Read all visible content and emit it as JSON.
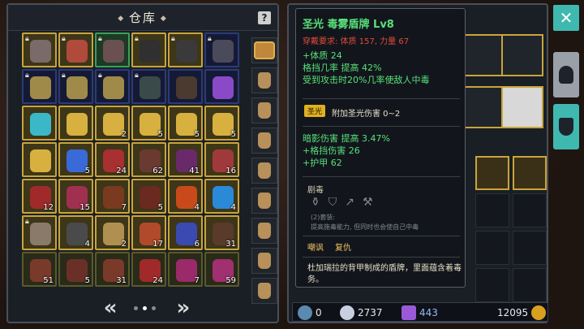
{
  "warehouse": {
    "title": "仓库",
    "help_label": "?",
    "pager": {
      "prev": "«",
      "next": "»",
      "pages": 3,
      "current": 2
    },
    "slots": [
      {
        "count": "",
        "color": "#7a6a6a",
        "rarity": "gold",
        "locked": true
      },
      {
        "count": "",
        "color": "#b04a3a",
        "rarity": "gold",
        "locked": true
      },
      {
        "count": "",
        "color": "#6a5050",
        "rarity": "green",
        "locked": true
      },
      {
        "count": "",
        "color": "#303030",
        "rarity": "gold",
        "locked": true
      },
      {
        "count": "",
        "color": "#3a3a3a",
        "rarity": "gold",
        "locked": true
      },
      {
        "count": "",
        "color": "#4a4a5a",
        "rarity": "blue",
        "locked": true
      },
      {
        "count": "",
        "color": "#a08a4a",
        "rarity": "blue",
        "locked": true
      },
      {
        "count": "",
        "color": "#a08a4a",
        "rarity": "blue",
        "locked": true
      },
      {
        "count": "",
        "color": "#a08a4a",
        "rarity": "blue",
        "locked": true
      },
      {
        "count": "",
        "color": "#3a4a4a",
        "rarity": "blue",
        "locked": true
      },
      {
        "count": "",
        "color": "#4a3a30",
        "rarity": "blue",
        "locked": false
      },
      {
        "count": "",
        "color": "#8a4ac8",
        "rarity": "blue",
        "locked": false
      },
      {
        "count": "",
        "color": "#3ab8c8",
        "rarity": "gold",
        "locked": false
      },
      {
        "count": "",
        "color": "#d8b040",
        "rarity": "gold",
        "locked": false
      },
      {
        "count": "2",
        "color": "#d8b040",
        "rarity": "gold",
        "locked": false
      },
      {
        "count": "5",
        "color": "#d8b040",
        "rarity": "gold",
        "locked": false
      },
      {
        "count": "5",
        "color": "#d8b040",
        "rarity": "gold",
        "locked": false
      },
      {
        "count": "5",
        "color": "#d8b040",
        "rarity": "gold",
        "locked": false
      },
      {
        "count": "",
        "color": "#d8b040",
        "rarity": "gold",
        "locked": false
      },
      {
        "count": "5",
        "color": "#3a6ad8",
        "rarity": "gold",
        "locked": false
      },
      {
        "count": "24",
        "color": "#a83030",
        "rarity": "gold",
        "locked": false
      },
      {
        "count": "62",
        "color": "#6a3a30",
        "rarity": "gold",
        "locked": false
      },
      {
        "count": "41",
        "color": "#6a2a6a",
        "rarity": "gold",
        "locked": false
      },
      {
        "count": "16",
        "color": "#a03a3a",
        "rarity": "gold",
        "locked": false
      },
      {
        "count": "12",
        "color": "#a02a2a",
        "rarity": "gold",
        "locked": false
      },
      {
        "count": "15",
        "color": "#a03050",
        "rarity": "gold",
        "locked": false
      },
      {
        "count": "7",
        "color": "#7a3a20",
        "rarity": "gold",
        "locked": false
      },
      {
        "count": "5",
        "color": "#6a2a20",
        "rarity": "gold",
        "locked": false
      },
      {
        "count": "4",
        "color": "#c84a1a",
        "rarity": "gold",
        "locked": false
      },
      {
        "count": "4",
        "color": "#2a8ad8",
        "rarity": "gold",
        "locked": false
      },
      {
        "count": "",
        "color": "#8a7a6a",
        "rarity": "gold",
        "locked": true
      },
      {
        "count": "4",
        "color": "#4a4a4a",
        "rarity": "gold",
        "locked": false
      },
      {
        "count": "2",
        "color": "#b09050",
        "rarity": "gold",
        "locked": false
      },
      {
        "count": "17",
        "color": "#b04a2a",
        "rarity": "gold",
        "locked": false
      },
      {
        "count": "6",
        "color": "#3a4ab0",
        "rarity": "gold",
        "locked": false
      },
      {
        "count": "31",
        "color": "#5a3a2a",
        "rarity": "gold",
        "locked": false
      },
      {
        "count": "51",
        "color": "#7a3a2a",
        "rarity": "dark",
        "locked": false
      },
      {
        "count": "5",
        "color": "#6a3028",
        "rarity": "dark",
        "locked": false
      },
      {
        "count": "31",
        "color": "#7a3a2a",
        "rarity": "dark",
        "locked": false
      },
      {
        "count": "24",
        "color": "#a02a2a",
        "rarity": "dark",
        "locked": false
      },
      {
        "count": "7",
        "color": "#9a2a6a",
        "rarity": "dark",
        "locked": false
      },
      {
        "count": "59",
        "color": "#a03070",
        "rarity": "dark",
        "locked": false
      }
    ],
    "side_bags": [
      "chest",
      "bag",
      "bag",
      "bag",
      "bag",
      "bag",
      "bag",
      "bag",
      "bag"
    ]
  },
  "tooltip": {
    "title": "圣光  毒雾盾牌  Lv8",
    "requirement": "穿戴要求:  体质 157, 力量 67",
    "stats_main": [
      "+体质 24",
      "格挡几率 提高 42%",
      "受到攻击时20%几率使敌人中毒"
    ],
    "badge": "圣光",
    "badge_text": "附加圣光伤害 0~2",
    "stats_secondary": [
      "暗影伤害 提高 3.47%",
      "+格挡伤害 26",
      "+护甲 62"
    ],
    "set_name": "剧毒",
    "set_icons": [
      "⚱",
      "⛉",
      "↗",
      "⚒"
    ],
    "set_bonus": "(2)套装:\n提高施毒能力, 但同时也会使自己中毒",
    "skills": [
      "嘲讽",
      "复仇"
    ],
    "description": "杜加瑞拉的背甲制成的盾牌，里面蕴含着毒务。"
  },
  "status_bar": {
    "skill_points": "0",
    "gems": "2737",
    "crystals": "443",
    "gold": "12095"
  },
  "colors": {
    "accent_teal": "#3fb8b0",
    "stat_green": "#58e07a",
    "requirement_red": "#e04a3a",
    "gold_border": "#c9a43a"
  },
  "right_panel": {
    "close_icon": "close-icon",
    "tabs": [
      "helmet-tab",
      "shield-tab"
    ]
  }
}
